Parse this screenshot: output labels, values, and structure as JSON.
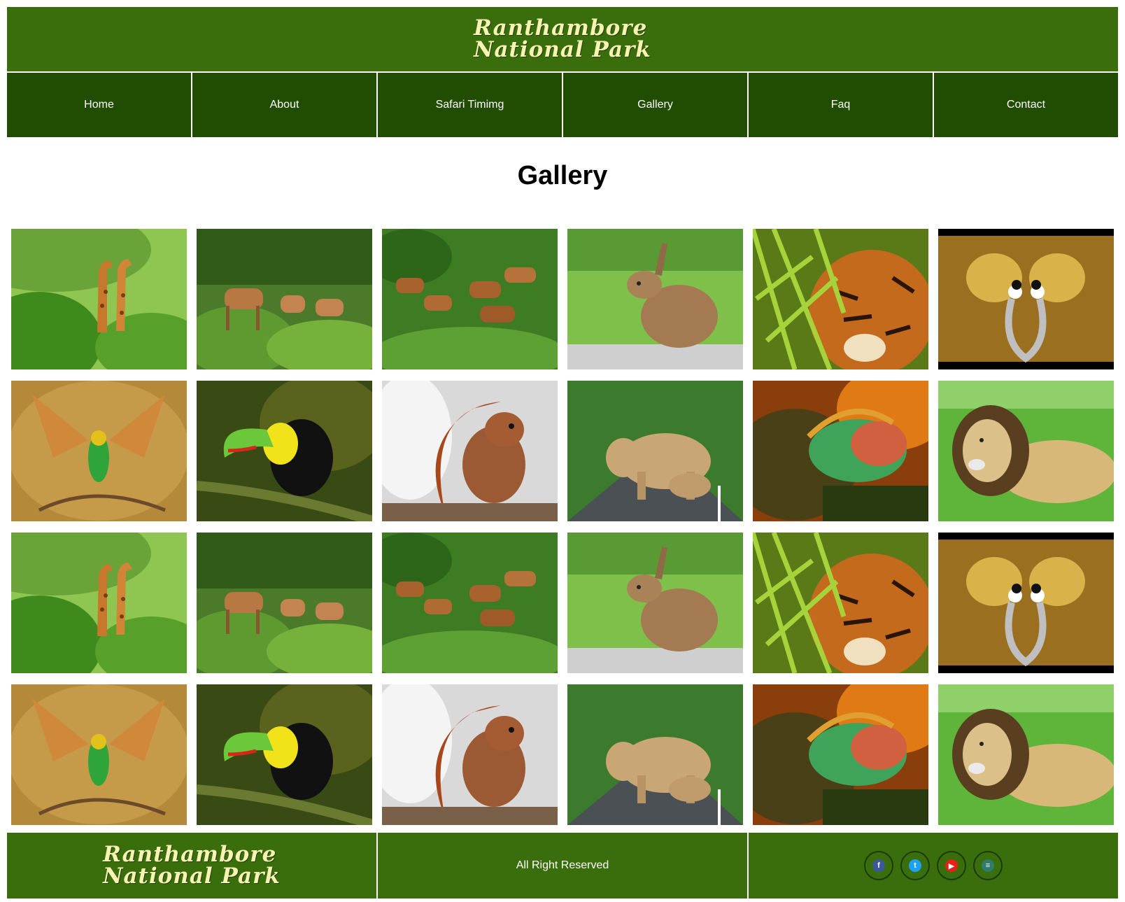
{
  "header": {
    "logo_line1": "Ranthambore",
    "logo_line2": "National Park"
  },
  "nav": {
    "items": [
      "Home",
      "About",
      "Safari Timimg",
      "Gallery",
      "Faq",
      "Contact"
    ]
  },
  "page": {
    "title": "Gallery"
  },
  "gallery": {
    "rows": [
      [
        "giraffes",
        "deer-in-forest",
        "spotted-deer-herd",
        "hare",
        "tiger-in-bamboo",
        "crowned-cranes"
      ],
      [
        "bee-eater-bird",
        "toucan",
        "squirrel",
        "elephants-crossing-road",
        "iguana",
        "lion"
      ],
      [
        "giraffes",
        "deer-in-forest",
        "spotted-deer-herd",
        "hare",
        "tiger-in-bamboo",
        "crowned-cranes"
      ],
      [
        "bee-eater-bird",
        "toucan",
        "squirrel",
        "elephants-crossing-road",
        "iguana",
        "lion"
      ]
    ]
  },
  "footer": {
    "logo_line1": "Ranthambore",
    "logo_line2": "National Park",
    "copyright": "All Right Reserved",
    "social": [
      {
        "icon": "facebook-icon",
        "glyph": "f",
        "color": "#3b5998"
      },
      {
        "icon": "twitter-icon",
        "glyph": "t",
        "color": "#1da1f2"
      },
      {
        "icon": "youtube-icon",
        "glyph": "▶",
        "color": "#e62117"
      },
      {
        "icon": "web-icon",
        "glyph": "≡",
        "color": "#2e7d6b"
      }
    ]
  },
  "colors": {
    "header_green": "#3a6e0d",
    "nav_green": "#214d03",
    "logo_cream": "#f7f3b3"
  }
}
